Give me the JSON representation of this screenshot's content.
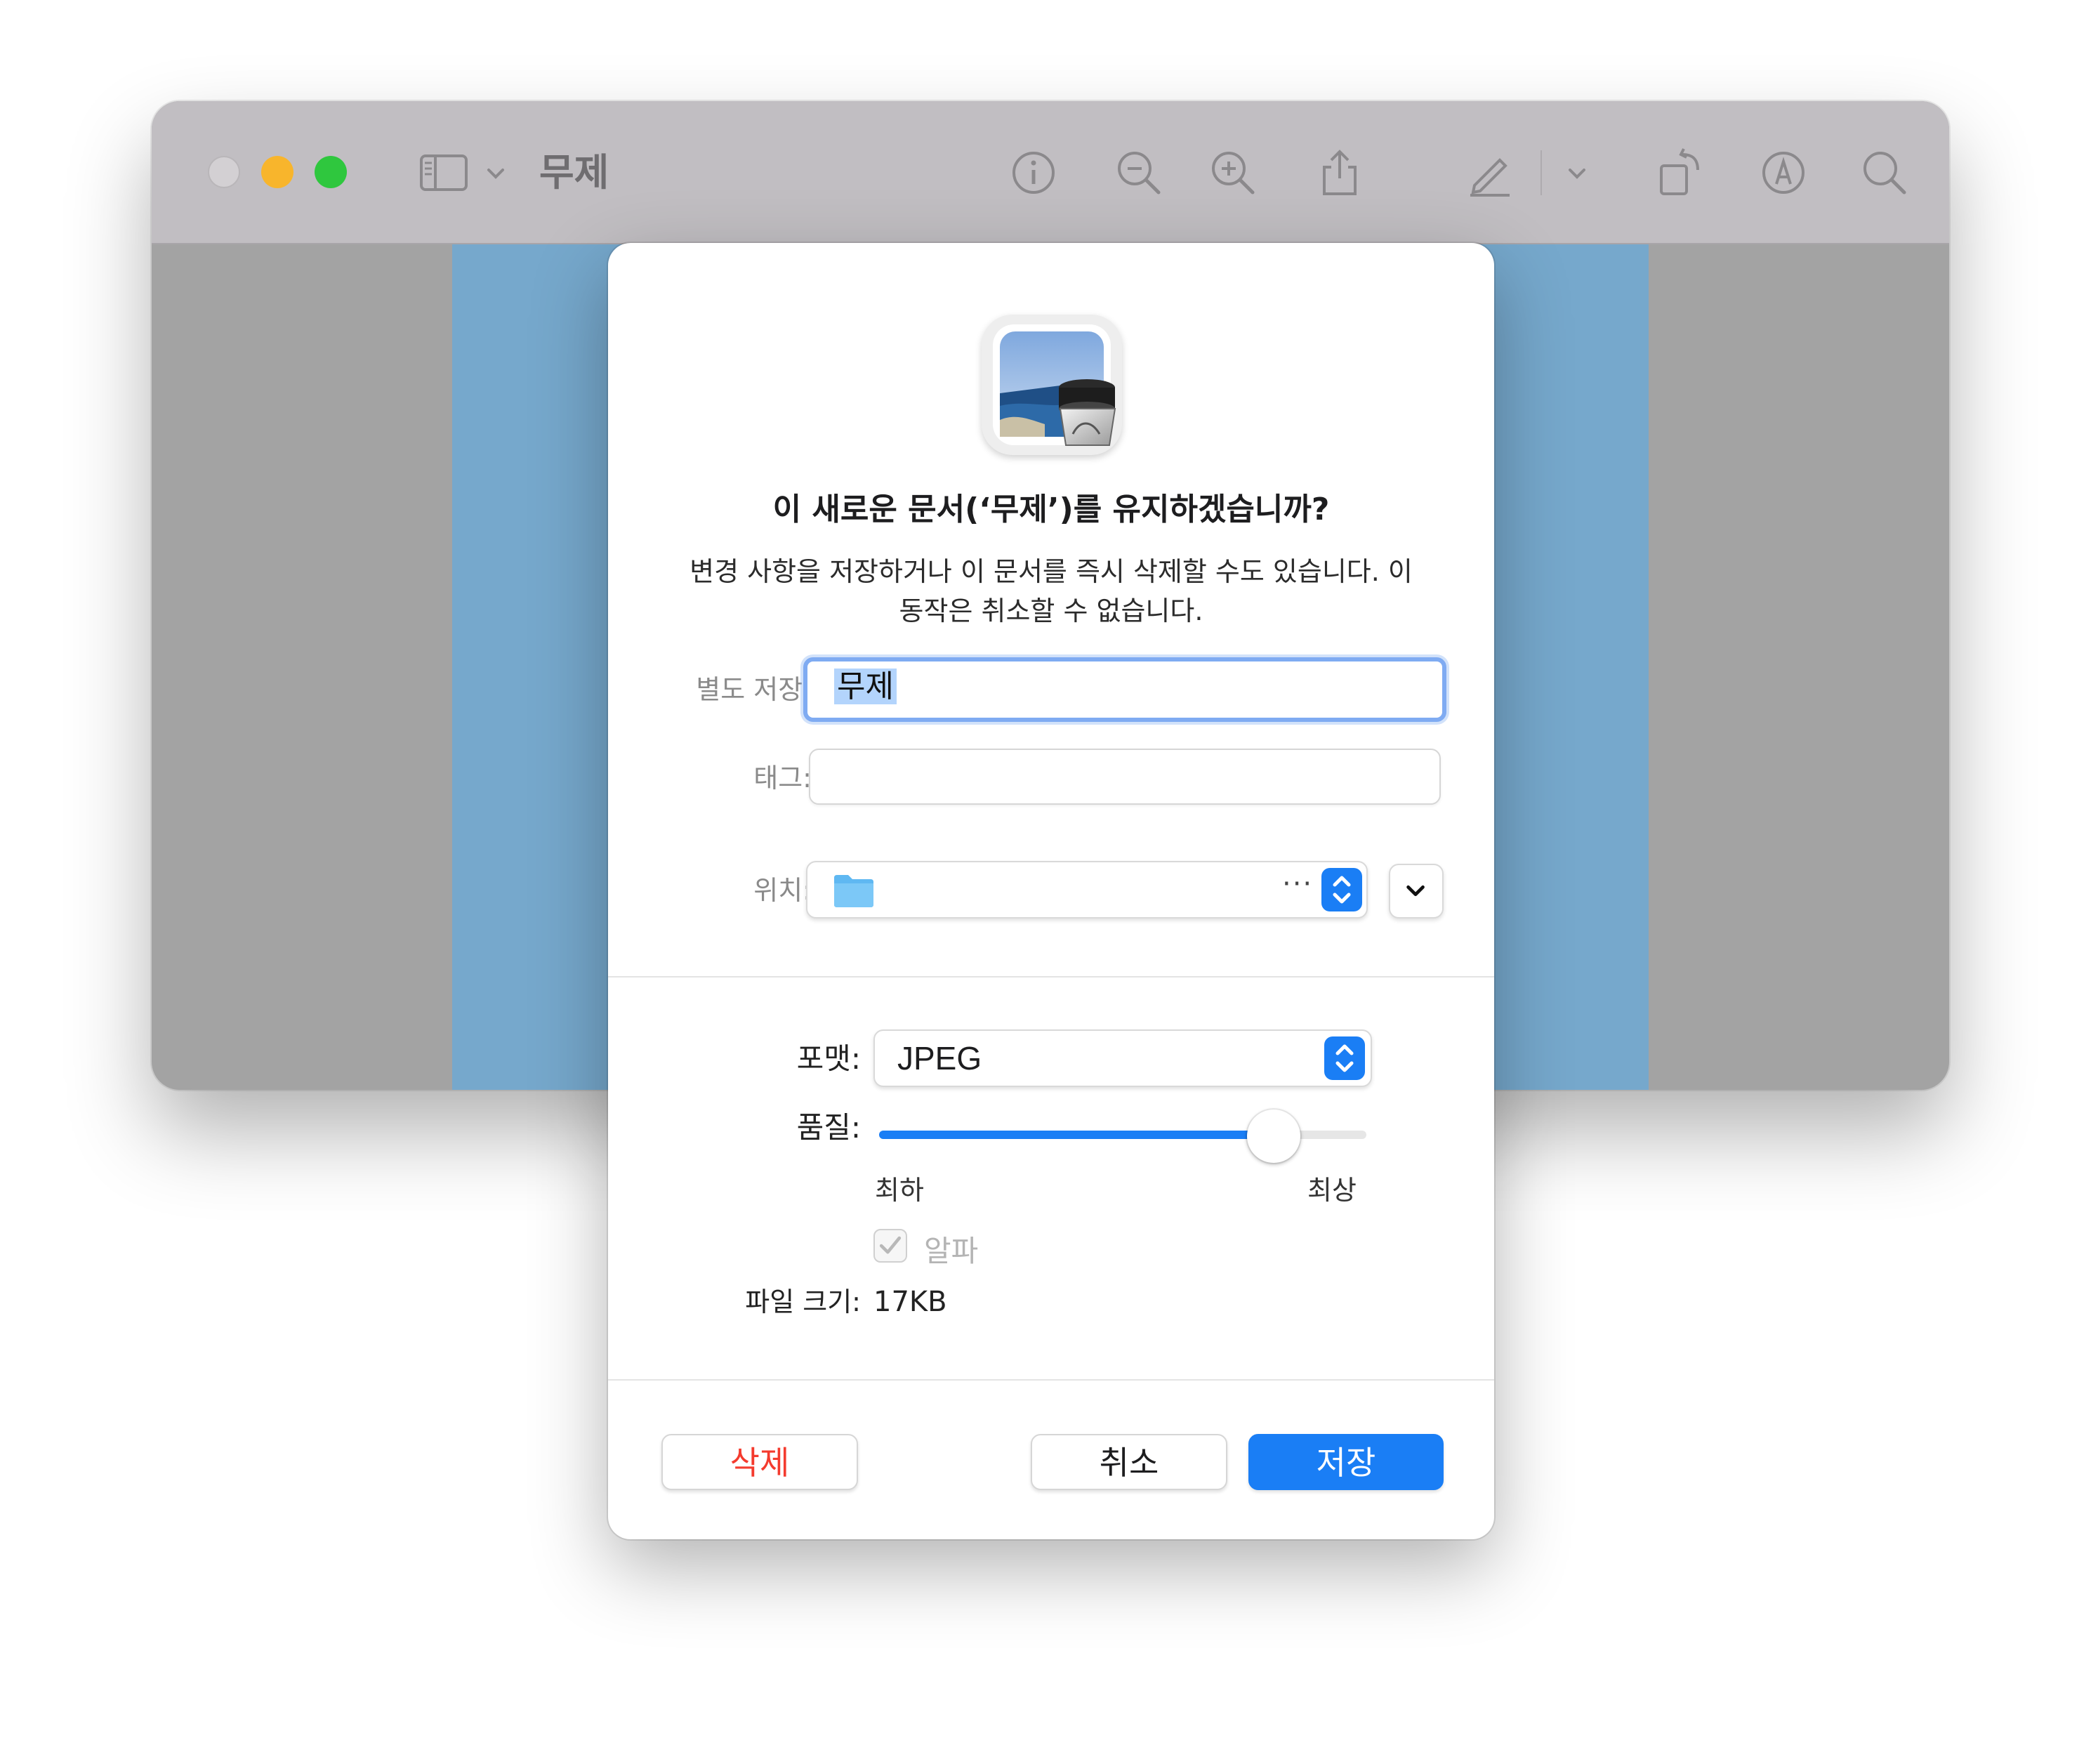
{
  "window": {
    "title": "무제",
    "toolbar_icons": [
      "sidebar-icon",
      "chevron-down-icon",
      "info-icon",
      "zoom-out-icon",
      "zoom-in-icon",
      "share-icon",
      "markup-pencil-icon",
      "chevron-down-icon",
      "rotate-icon",
      "markup-icon",
      "search-icon"
    ]
  },
  "dialog": {
    "title": "이 새로운 문서(‘무제’)를 유지하겠습니까?",
    "message_line1": "변경 사항을 저장하거나 이 문서를 즉시 삭제할 수도 있습니다. 이",
    "message_line2": "동작은 취소할 수 없습니다.",
    "save_as_label": "별도 저장:",
    "save_as_value": "무제",
    "tags_label": "태그:",
    "tags_value": "",
    "location_label": "위치:",
    "location_ellipsis": "···",
    "format_label": "포맷:",
    "format_value": "JPEG",
    "quality_label": "품질:",
    "quality_fraction": 0.81,
    "quality_min_label": "최하",
    "quality_max_label": "최상",
    "alpha_label": "알파",
    "alpha_checked": true,
    "alpha_enabled": false,
    "file_size_label": "파일 크기:",
    "file_size_value": "17KB",
    "delete_button": "삭제",
    "cancel_button": "취소",
    "save_button": "저장"
  },
  "colors": {
    "accent": "#1a7ef5",
    "destructive": "#f43b2e",
    "focus_ring": "#7fabf2",
    "document_background": "#76a8cc"
  }
}
